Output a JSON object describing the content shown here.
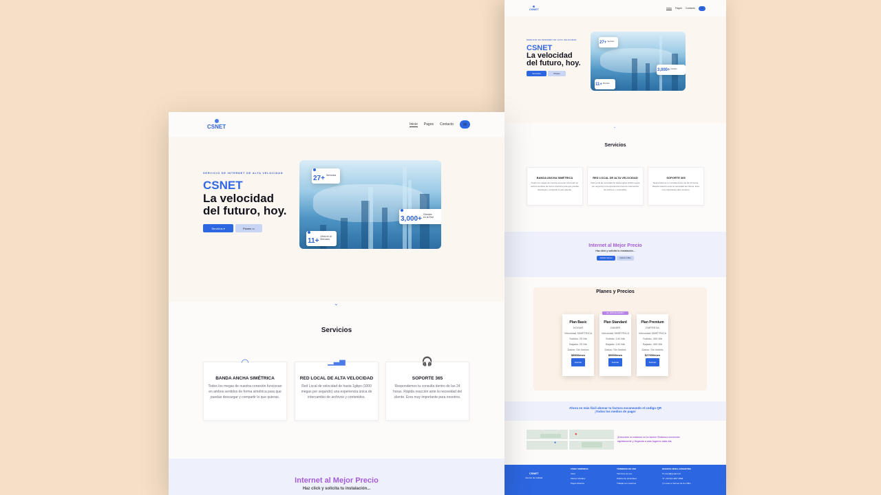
{
  "brand": {
    "logo_text": "CSNET",
    "accent": "#2c66e0",
    "purple": "#a45bd6",
    "background": "#f6dfc6"
  },
  "nav": {
    "items": [
      "Inicio",
      "Pagos",
      "Contacto"
    ],
    "chat_icon": "chat-bubble-icon"
  },
  "hero": {
    "eyebrow": "SERVICIO DE INTERNET DE ALTA VELOCIDAD",
    "brand": "CSNET",
    "headline_1": "La velocidad",
    "headline_2": "del futuro, hoy.",
    "btn_services": "Servicios",
    "btn_plans": "Planes",
    "stat_services": {
      "num": "27+",
      "label": "Servicios"
    },
    "stat_clients": {
      "num": "3,000+",
      "label_1": "Clientes",
      "label_2": "en la Red"
    },
    "stat_years": {
      "num": "11+",
      "label_1": "Años en el",
      "label_2": "Mercado"
    }
  },
  "services": {
    "title": "Servicios",
    "items": [
      {
        "title": "BANDA ANCHA SIMÉTRICA",
        "icon": "wifi-icon",
        "desc": "Todos los megas de nuestra conexión funcionan en ambos sentidos de forma simétrica para que puedas descargar y compartir lo que quieras."
      },
      {
        "title": "RED LOCAL DE ALTA VELOCIDAD",
        "icon": "signal-bars-icon",
        "desc": "Red Local de velocidad de hasta 1gbps (1000 megas por segundo) una experiencia única de intercambio de archivos y contenidos."
      },
      {
        "title": "SOPORTE 365",
        "icon": "headset-icon",
        "desc": "Respondemos tu consulta dentro de las 24 horas. Rápida reacción ante la necesidad del cliente. Eres muy importante para nosotros."
      }
    ]
  },
  "promo": {
    "title": "Internet al Mejor Precio",
    "subtitle": "Haz click y solicita tu instalación...",
    "btn_a": "Solicitar Internet",
    "btn_b": "Ahorrar el Mes"
  },
  "plans": {
    "title": "Planes y Precios",
    "items": [
      {
        "name": "Plan Basic",
        "tier": "HOGAR",
        "tag": "",
        "lines": [
          "Velocidad SIMÉTRICA",
          "Subida: 20 Mb",
          "Bajada: 20 Mb",
          "Datos: Sin límites"
        ],
        "price": "$8500/mes",
        "cta": "Solicitar"
      },
      {
        "name": "Plan Standard",
        "tier": "GAMER",
        "tag": "EL MÁS ELEGIDO",
        "lines": [
          "Velocidad SIMÉTRICA",
          "Subida: 100 Mb",
          "Bajada: 100 Mb",
          "Datos: Sin límites"
        ],
        "price": "$9000/mes",
        "cta": "Solicitar"
      },
      {
        "name": "Plan Premium",
        "tier": "EMPRESA",
        "tag": "",
        "lines": [
          "Velocidad SIMÉTRICA",
          "Subida: 300 Mb",
          "Bajada: 300 Mb",
          "Datos: Sin límites"
        ],
        "price": "$27000/mes",
        "cta": "Solicitar"
      }
    ]
  },
  "qr": {
    "line_1": "Ahora es más fácil abonar tu factura escaneando el codigo QR",
    "line_2": "¡Todos los medios de pago!"
  },
  "map_text": {
    "line_1": "¡Descubre si estamos en tu barrio! Estamos creciendo",
    "line_2": "rápidamente y llegando a más lugares cada día."
  },
  "footer": {
    "tagline": "Internet de Calidad",
    "col1": {
      "title": "CSNET EMPRESA",
      "items": [
        "Inicio",
        "Planes Actuales",
        "Pagos Abiertos"
      ]
    },
    "col2": {
      "title": "TÉRMINOS DE USO",
      "items": [
        "Términos de uso",
        "Política de privacidad",
        "Trabaja con nosotros"
      ]
    },
    "col3": {
      "title": "BUENOS AIRES, ARGENTINA",
      "items": [
        "csnet@gmail.com",
        "+54 911 4457 2898",
        "Lunes a Viernes de 9 a 18hs"
      ]
    }
  }
}
